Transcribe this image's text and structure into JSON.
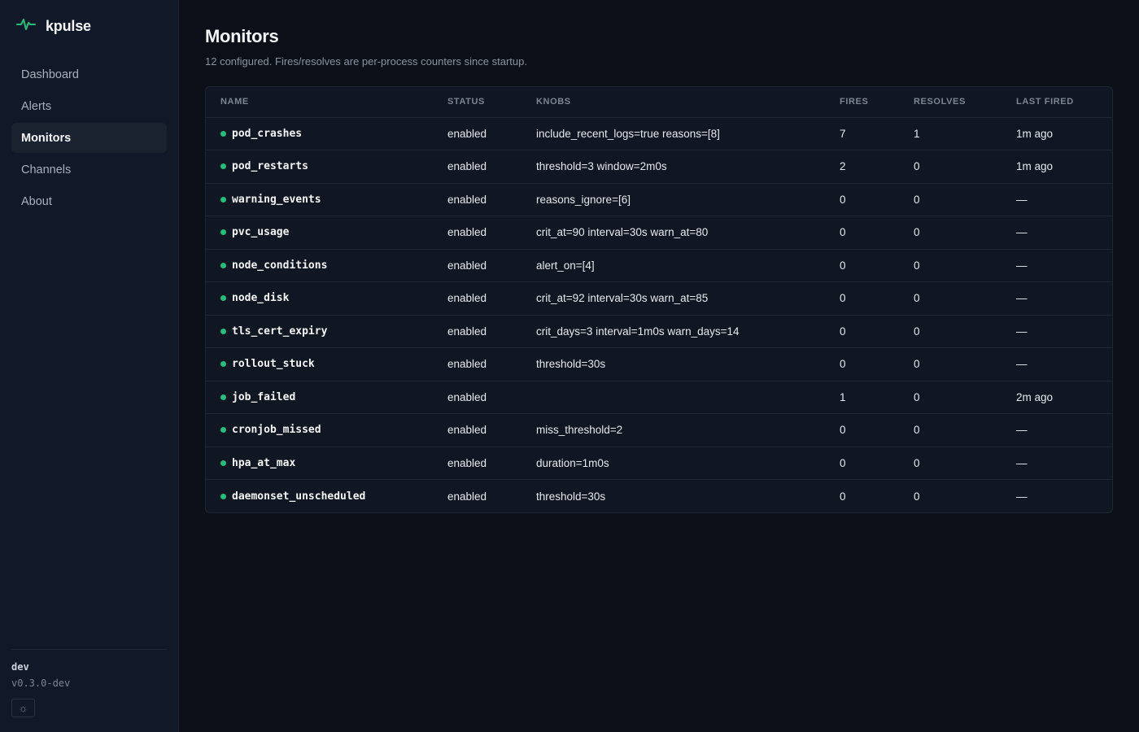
{
  "brand": {
    "name": "kpulse",
    "accent": "#22c079"
  },
  "nav": {
    "items": [
      {
        "label": "Dashboard"
      },
      {
        "label": "Alerts"
      },
      {
        "label": "Monitors"
      },
      {
        "label": "Channels"
      },
      {
        "label": "About"
      }
    ],
    "active": "Monitors"
  },
  "footer": {
    "env": "dev",
    "version": "v0.3.0-dev",
    "theme_icon": "sun-icon"
  },
  "page": {
    "title": "Monitors",
    "subtitle": "12 configured. Fires/resolves are per-process counters since startup."
  },
  "table": {
    "headers": {
      "name": "NAME",
      "status": "STATUS",
      "knobs": "KNOBS",
      "fires": "FIRES",
      "resolves": "RESOLVES",
      "last_fired": "LAST FIRED"
    },
    "rows": [
      {
        "name": "pod_crashes",
        "status": "enabled",
        "knobs": "include_recent_logs=true reasons=[8]",
        "fires": "7",
        "resolves": "1",
        "last_fired": "1m ago"
      },
      {
        "name": "pod_restarts",
        "status": "enabled",
        "knobs": "threshold=3 window=2m0s",
        "fires": "2",
        "resolves": "0",
        "last_fired": "1m ago"
      },
      {
        "name": "warning_events",
        "status": "enabled",
        "knobs": "reasons_ignore=[6]",
        "fires": "0",
        "resolves": "0",
        "last_fired": "—"
      },
      {
        "name": "pvc_usage",
        "status": "enabled",
        "knobs": "crit_at=90 interval=30s warn_at=80",
        "fires": "0",
        "resolves": "0",
        "last_fired": "—"
      },
      {
        "name": "node_conditions",
        "status": "enabled",
        "knobs": "alert_on=[4]",
        "fires": "0",
        "resolves": "0",
        "last_fired": "—"
      },
      {
        "name": "node_disk",
        "status": "enabled",
        "knobs": "crit_at=92 interval=30s warn_at=85",
        "fires": "0",
        "resolves": "0",
        "last_fired": "—"
      },
      {
        "name": "tls_cert_expiry",
        "status": "enabled",
        "knobs": "crit_days=3 interval=1m0s warn_days=14",
        "fires": "0",
        "resolves": "0",
        "last_fired": "—"
      },
      {
        "name": "rollout_stuck",
        "status": "enabled",
        "knobs": "threshold=30s",
        "fires": "0",
        "resolves": "0",
        "last_fired": "—"
      },
      {
        "name": "job_failed",
        "status": "enabled",
        "knobs": "",
        "fires": "1",
        "resolves": "0",
        "last_fired": "2m ago"
      },
      {
        "name": "cronjob_missed",
        "status": "enabled",
        "knobs": "miss_threshold=2",
        "fires": "0",
        "resolves": "0",
        "last_fired": "—"
      },
      {
        "name": "hpa_at_max",
        "status": "enabled",
        "knobs": "duration=1m0s",
        "fires": "0",
        "resolves": "0",
        "last_fired": "—"
      },
      {
        "name": "daemonset_unscheduled",
        "status": "enabled",
        "knobs": "threshold=30s",
        "fires": "0",
        "resolves": "0",
        "last_fired": "—"
      }
    ]
  }
}
